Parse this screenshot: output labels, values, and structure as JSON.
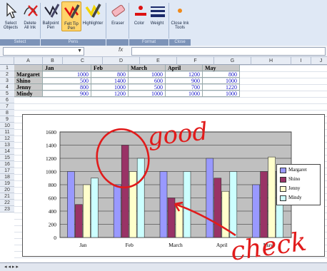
{
  "ribbon": {
    "buttons": [
      {
        "label": "Select Objects",
        "icon": "cursor-arrow-icon"
      },
      {
        "label": "Delete All Ink",
        "icon": "delete-ink-icon"
      },
      {
        "label": "Ballpoint Pen",
        "icon": "ballpoint-pen-icon"
      },
      {
        "label": "Felt Tip Pen",
        "icon": "felt-tip-pen-icon",
        "active": true
      },
      {
        "label": "Highlighter",
        "icon": "highlighter-icon"
      },
      {
        "label": "Eraser",
        "icon": "eraser-icon"
      },
      {
        "label": "Color",
        "icon": "color-icon"
      },
      {
        "label": "Weight",
        "icon": "weight-icon"
      },
      {
        "label": "Close Ink Tools",
        "icon": "close-ink-icon"
      }
    ],
    "groups": {
      "select": "Select",
      "pens": "Pens",
      "format": "Format",
      "close": "Close"
    }
  },
  "formula_bar": {
    "name_box": "",
    "fx": "fx",
    "value": ""
  },
  "columns": [
    "A",
    "B",
    "C",
    "D",
    "E",
    "F",
    "G",
    "H",
    "I",
    "J",
    "K"
  ],
  "rows": [
    "1",
    "2",
    "3",
    "4",
    "5",
    "6",
    "7",
    "8",
    "9",
    "10",
    "11",
    "12",
    "13",
    "14",
    "15",
    "16",
    "17",
    "18",
    "19",
    "20",
    "21",
    "22",
    "23"
  ],
  "table": {
    "header": [
      "Jan",
      "Feb",
      "March",
      "April",
      "May"
    ],
    "rows": [
      {
        "name": "Margaret",
        "values": [
          "1000",
          "800",
          "1000",
          "1200",
          "800"
        ]
      },
      {
        "name": "Shino",
        "values": [
          "500",
          "1400",
          "600",
          "900",
          "1000"
        ]
      },
      {
        "name": "Jenny",
        "values": [
          "800",
          "1000",
          "500",
          "700",
          "1220"
        ]
      },
      {
        "name": "Mindy",
        "values": [
          "900",
          "1200",
          "1000",
          "1000",
          "1000"
        ]
      }
    ]
  },
  "chart_data": {
    "type": "bar",
    "categories": [
      "Jan",
      "Feb",
      "March",
      "April",
      "May"
    ],
    "series": [
      {
        "name": "Margaret",
        "values": [
          1000,
          800,
          1000,
          1200,
          800
        ],
        "color": "#9999ff"
      },
      {
        "name": "Shino",
        "values": [
          500,
          1400,
          600,
          900,
          1000
        ],
        "color": "#993366"
      },
      {
        "name": "Jenny",
        "values": [
          800,
          1000,
          500,
          700,
          1220
        ],
        "color": "#ffffcc"
      },
      {
        "name": "Mindy",
        "values": [
          900,
          1200,
          1000,
          1000,
          1000
        ],
        "color": "#ccffff"
      }
    ],
    "yticks": [
      "0",
      "200",
      "400",
      "600",
      "800",
      "1000",
      "1200",
      "1400",
      "1600"
    ],
    "ylim": [
      0,
      1600
    ],
    "grid": true,
    "legend": "right"
  },
  "annotations": {
    "good": "good",
    "check": "check",
    "ink_color": "#e11b1b"
  }
}
